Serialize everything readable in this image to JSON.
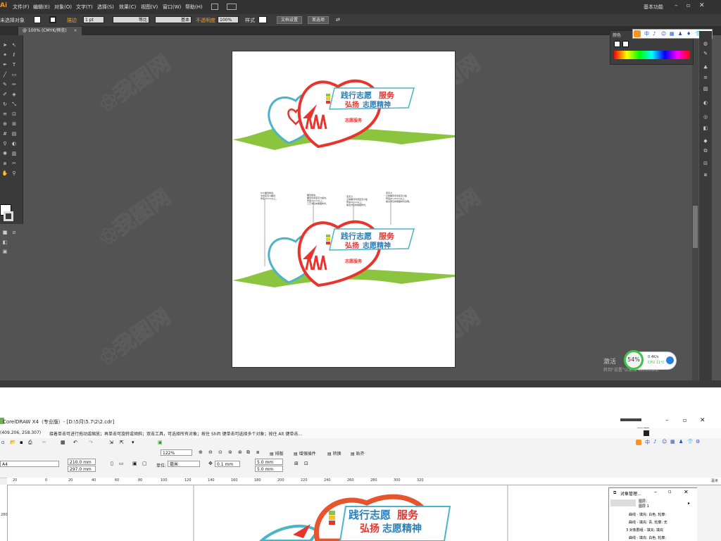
{
  "illustrator": {
    "app_logo": "Ai",
    "menus": [
      "文件(F)",
      "编辑(E)",
      "对象(O)",
      "文字(T)",
      "选择(S)",
      "效果(C)",
      "视图(V)",
      "窗口(W)",
      "帮助(H)"
    ],
    "workspace": "基本功能",
    "control_bar": {
      "selection": "未选择对象",
      "stroke_label": "描边",
      "stroke_weight": "1 pt",
      "stroke_profile": "等比",
      "brush": "基本",
      "opacity_label": "不透明度",
      "opacity_value": "100%",
      "style_label": "样式",
      "doc_setup_button": "文档设置",
      "preferences_button": "首选项"
    },
    "doc_tab": "@ 100% (CMYK/预览)",
    "color_panel_tab": "颜色",
    "ime_chars": [
      "中",
      "♪",
      "☺",
      "▦",
      "♟",
      "♦",
      "👕",
      "⚙"
    ],
    "windows_activate": "激活",
    "windows_activate_sub": "转到\"设置\"以激活 Windows。",
    "perf_widget": {
      "percent": "54%",
      "net": "0.4K/s",
      "cpu": "CPU 11℃"
    },
    "artwork": {
      "line1_a": "践行志愿",
      "line1_b": "服务",
      "line2_a": "弘扬",
      "line2_b": "志愿精神",
      "badge": "志愿服务",
      "annotations": [
        "PVC雕刻烤漆，\n专用亚克力雕刻\n厚度20mm以上，",
        "雕刻烤漆，\n雕刻专用亚克力板材，\n厚度20mm以上，\n工艺详见效果图样式。",
        "亚克力\n立体雕刻专用亚克力板\n厚度20mm以上，\n做法详见效果图样式。",
        "亚克力\n立体雕刻专用亚克力板\n厚度15-20mm以上，\n做法详见效果图样式说明。"
      ]
    },
    "colors": {
      "red": "#e8342c",
      "teal": "#4bb4c8",
      "green": "#8bc53f",
      "text_blue": "#2a7fb8",
      "text_red": "#e8342c"
    }
  },
  "coreldraw": {
    "title": "CorelDRAW X4（专业版）- [D:\\5月\\5.7\\2\\2.cdr]",
    "coords": "(409.206, 258.307)",
    "hint": "接着单击可进行拖动或缩放；再单击可旋转或倾斜；双击工具，可选择所有对象；按住 Shift 键单击可选择多个对象；按住 Alt 键单击...",
    "plugins": [
      "排版",
      "增强插件",
      "转换",
      "贴齐"
    ],
    "zoom": "122%",
    "page_size": "A4",
    "width": "210.0 mm",
    "height": "297.0 mm",
    "units_label": "单位:",
    "units": "毫米",
    "nudge": "0.1 mm",
    "dup_x": "5.0 mm",
    "dup_y": "5.0 mm",
    "ruler_ticks": [
      "20",
      "0",
      "20",
      "40",
      "60",
      "80",
      "100",
      "120",
      "140",
      "160",
      "180",
      "200",
      "220",
      "240",
      "260",
      "280",
      "300",
      "320"
    ],
    "ruler_unit": "毫米",
    "ruler_v_label": "280",
    "canvas_line1_a": "践行志愿",
    "canvas_line1_b": "服务",
    "canvas_line2_a": "弘扬",
    "canvas_line2_b": "志愿精神",
    "object_manager": {
      "title": "对象管理...",
      "layer1": "图层：",
      "layer2": "图层 1",
      "rows": [
        "曲线 - 填充: 白色, 轮廓:",
        "曲线 - 填充: 青, 轮廓: 无",
        "3 对象群组 - 填充: 填充",
        "曲线 - 填充: 白色, 轮廓:"
      ]
    }
  }
}
